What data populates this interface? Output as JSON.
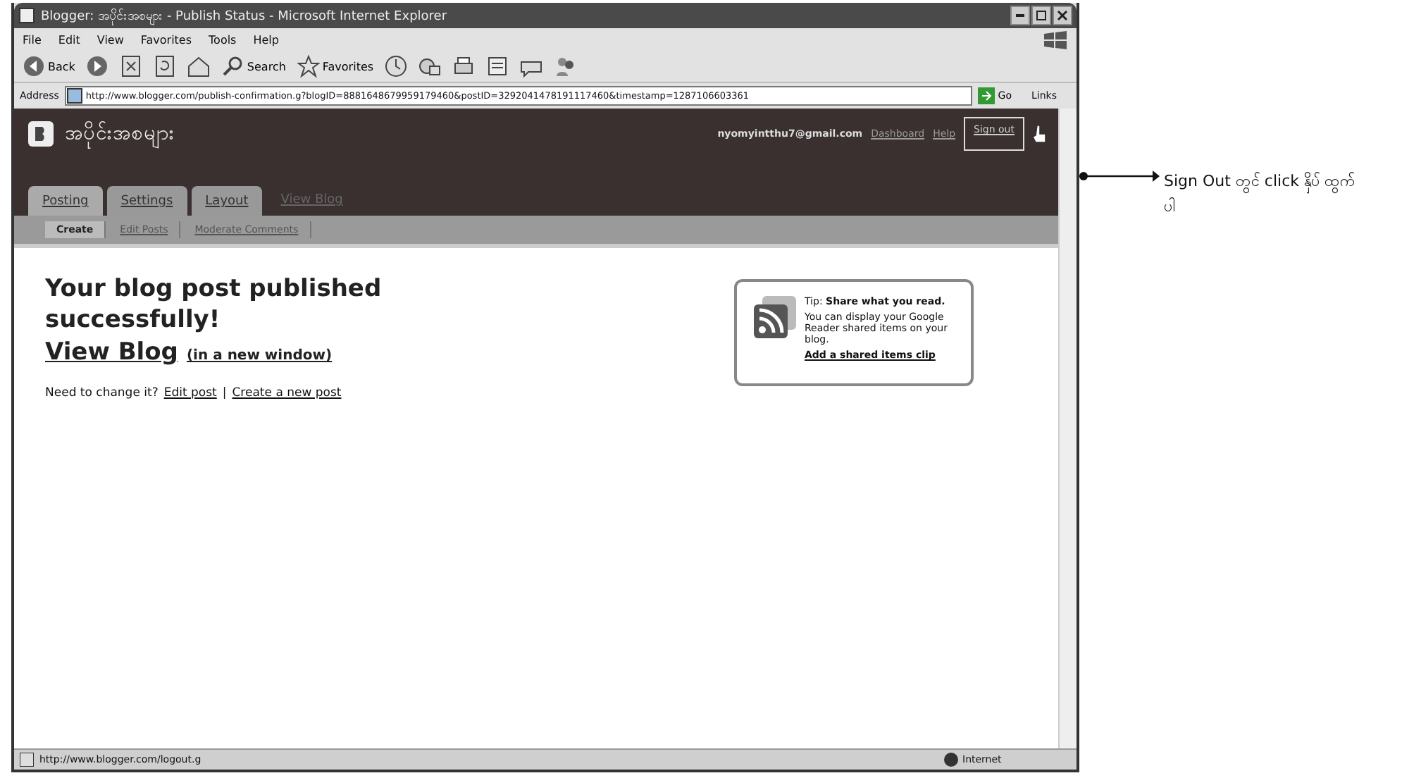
{
  "window": {
    "title": "Blogger: အပိုင်းအစများ - Publish Status - Microsoft Internet Explorer"
  },
  "menu": [
    "File",
    "Edit",
    "View",
    "Favorites",
    "Tools",
    "Help"
  ],
  "toolbar": [
    {
      "kind": "back",
      "label": "Back"
    },
    {
      "kind": "forward"
    },
    {
      "kind": "stop"
    },
    {
      "kind": "refresh"
    },
    {
      "kind": "home"
    },
    {
      "kind": "search",
      "label": "Search"
    },
    {
      "kind": "favorites",
      "label": "Favorites"
    },
    {
      "kind": "history"
    },
    {
      "kind": "mail"
    },
    {
      "kind": "print"
    },
    {
      "kind": "edit"
    },
    {
      "kind": "discuss"
    },
    {
      "kind": "messenger"
    }
  ],
  "address": {
    "label": "Address",
    "value": "http://www.blogger.com/publish-confirmation.g?blogID=8881648679959179460&postID=3292041478191117460&timestamp=1287106603361",
    "go": "Go",
    "links": "Links"
  },
  "blogger": {
    "blog_title": "အပိုင်းအစများ",
    "email": "nyomyintthu7@gmail.com",
    "nav": [
      "Dashboard",
      "Help"
    ],
    "sign_out": "Sign out",
    "tabs": [
      {
        "label": "Posting",
        "selected": true
      },
      {
        "label": "Settings",
        "selected": false
      },
      {
        "label": "Layout",
        "selected": false
      }
    ],
    "view_blog_tab": "View Blog",
    "subtabs": [
      {
        "label": "Create",
        "selected": true
      },
      {
        "label": "Edit Posts",
        "selected": false
      },
      {
        "label": "Moderate Comments",
        "selected": false
      }
    ]
  },
  "content": {
    "heading": "Your blog post published successfully!",
    "view_blog": "View Blog",
    "new_window": "(in a new window)",
    "change_prompt": "Need to change it?",
    "edit_post": "Edit post",
    "separator": "|",
    "create_post": "Create a new post",
    "tip": {
      "text": "Tip: **Share what you read.**",
      "body": "You can display your Google Reader shared items on your blog.",
      "link": "Add a shared items clip"
    }
  },
  "status_bar": {
    "url": "http://www.blogger.com/logout.g",
    "zone": "Internet"
  },
  "annotation": {
    "text": "Sign Out တွင် click နှိပ် ထွက်ပါ"
  }
}
